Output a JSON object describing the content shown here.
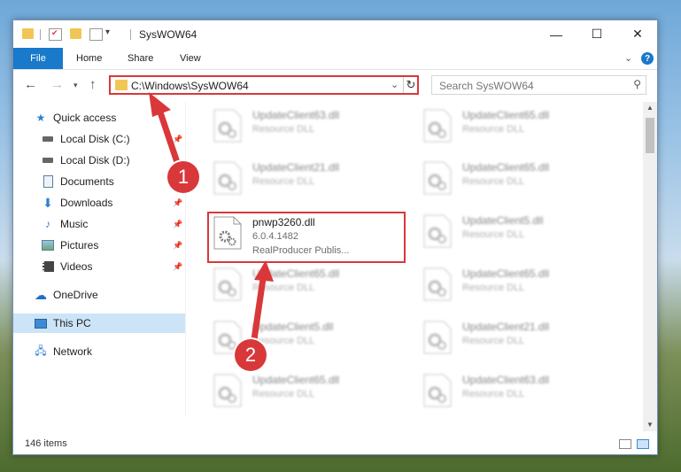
{
  "window": {
    "title": "SysWOW64"
  },
  "ribbon": {
    "tabs": [
      "File",
      "Home",
      "Share",
      "View"
    ]
  },
  "address_bar": {
    "path": "C:\\Windows\\SysWOW64"
  },
  "search": {
    "placeholder": "Search SysWOW64"
  },
  "sidebar": {
    "items": [
      {
        "label": "Quick access",
        "icon": "star-icon",
        "pinned": false
      },
      {
        "label": "Local Disk (C:)",
        "icon": "disk-icon",
        "pinned": true
      },
      {
        "label": "Local Disk (D:)",
        "icon": "disk-icon",
        "pinned": false
      },
      {
        "label": "Documents",
        "icon": "document-icon",
        "pinned": true
      },
      {
        "label": "Downloads",
        "icon": "download-icon",
        "pinned": true
      },
      {
        "label": "Music",
        "icon": "music-icon",
        "pinned": true
      },
      {
        "label": "Pictures",
        "icon": "pictures-icon",
        "pinned": true
      },
      {
        "label": "Videos",
        "icon": "video-icon",
        "pinned": true
      },
      {
        "label": "OneDrive",
        "icon": "cloud-icon",
        "pinned": false
      },
      {
        "label": "This PC",
        "icon": "computer-icon",
        "pinned": false,
        "selected": true
      },
      {
        "label": "Network",
        "icon": "network-icon",
        "pinned": false
      }
    ]
  },
  "files": [
    {
      "name": "UpdateClient63.dll",
      "desc": "Resource DLL",
      "blurred": true
    },
    {
      "name": "UpdateClient65.dll",
      "desc": "Resource DLL",
      "blurred": true
    },
    {
      "name": "UpdateClient21.dll",
      "desc": "Resource DLL",
      "blurred": true
    },
    {
      "name": "UpdateClient65.dll",
      "desc": "Resource DLL",
      "blurred": true
    },
    {
      "name": "pnwp3260.dll",
      "desc": "6.0.4.1482",
      "desc2": "RealProducer Publis...",
      "blurred": false
    },
    {
      "name": "UpdateClient5.dll",
      "desc": "Resource DLL",
      "blurred": true
    },
    {
      "name": "UpdateClient65.dll",
      "desc": "Resource DLL",
      "blurred": true
    },
    {
      "name": "UpdateClient65.dll",
      "desc": "Resource DLL",
      "blurred": true
    },
    {
      "name": "UpdateClient5.dll",
      "desc": "Resource DLL",
      "blurred": true
    },
    {
      "name": "UpdateClient21.dll",
      "desc": "Resource DLL",
      "blurred": true
    },
    {
      "name": "UpdateClient65.dll",
      "desc": "Resource DLL",
      "blurred": true
    },
    {
      "name": "UpdateClient63.dll",
      "desc": "Resource DLL",
      "blurred": true
    }
  ],
  "status": {
    "item_count": "146 items"
  },
  "annotations": {
    "step1": "1",
    "step2": "2",
    "color": "#d9383a"
  }
}
